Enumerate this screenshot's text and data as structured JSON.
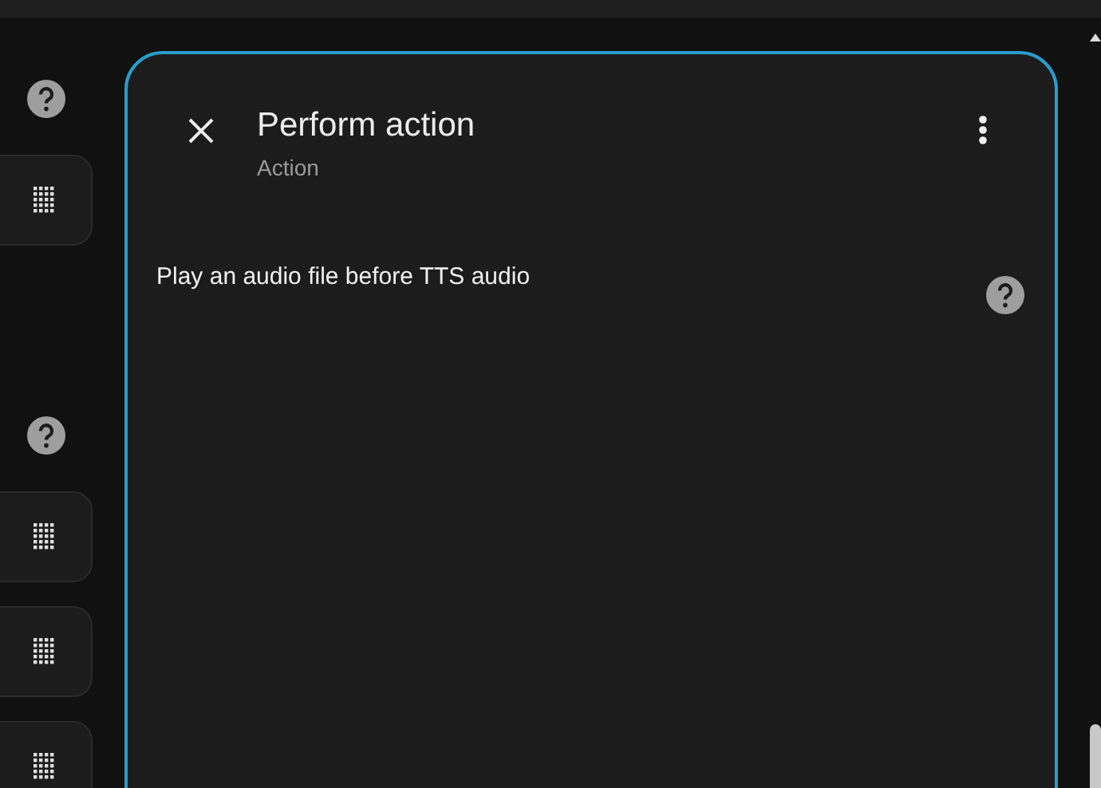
{
  "sidebar": [
    {
      "kind": "help"
    },
    {
      "kind": "card"
    },
    {
      "kind": "help"
    },
    {
      "kind": "card"
    },
    {
      "kind": "card"
    },
    {
      "kind": "card"
    }
  ],
  "dialog": {
    "title": "Perform action",
    "subtitle": "Action",
    "field_label": "Play an audio file before TTS audio"
  }
}
